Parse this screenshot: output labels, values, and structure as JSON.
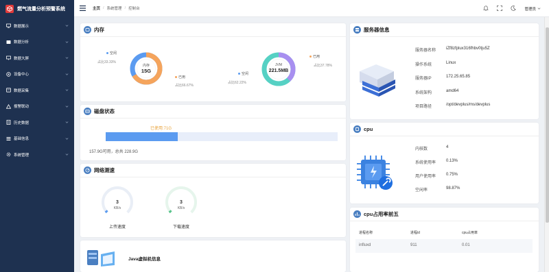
{
  "brand": {
    "title": "燃气流量分析预警系统"
  },
  "sidebar": {
    "items": [
      {
        "label": "数据展示",
        "icon": "monitor-icon"
      },
      {
        "label": "数据分析",
        "icon": "chart-icon"
      },
      {
        "label": "数据大屏",
        "icon": "screen-icon"
      },
      {
        "label": "设备中心",
        "icon": "device-icon"
      },
      {
        "label": "数据采集",
        "icon": "collect-icon"
      },
      {
        "label": "报警联动",
        "icon": "alarm-icon"
      },
      {
        "label": "历史数据",
        "icon": "history-icon"
      },
      {
        "label": "基础信息",
        "icon": "info-icon"
      },
      {
        "label": "系统管理",
        "icon": "gear-icon"
      }
    ]
  },
  "header": {
    "breadcrumb": [
      "主页",
      "系统管理",
      "控制台"
    ],
    "user": "管理员"
  },
  "memory": {
    "title": "内存",
    "ring1": {
      "center_label": "内存",
      "center_value": "15G",
      "free_label": "空闲",
      "free_pct": "占比33.33%",
      "used_label": "已用",
      "used_pct": "占比66.67%",
      "used_fraction": 0.6667
    },
    "ring2": {
      "center_label": "JVM",
      "center_value": "221.5MB",
      "free_label": "空闲",
      "free_pct": "占比62.22%",
      "used_label": "已用",
      "used_pct": "占比37.78%",
      "used_fraction": 0.3778
    }
  },
  "disk": {
    "title": "磁盘状态",
    "used_label": "已使用:71G",
    "used_fraction": 0.31,
    "summary": "157.9G可用，总共 228.9G"
  },
  "network": {
    "title": "网络测速",
    "upload": {
      "value": "3",
      "unit": "KB/s",
      "label": "上传速度"
    },
    "download": {
      "value": "3",
      "unit": "KB/s",
      "label": "下载速度"
    }
  },
  "java": {
    "title": "Java虚拟机信息"
  },
  "server": {
    "title": "服务器信息",
    "rows": [
      {
        "label": "服务器名称",
        "value": "iZf8zfplux316fhbv0tju5Z"
      },
      {
        "label": "操作系统",
        "value": "Linux"
      },
      {
        "label": "服务器IP",
        "value": "172.25.65.85"
      },
      {
        "label": "系统架构",
        "value": "amd64"
      },
      {
        "label": "项目路径",
        "value": "/opt/devplus/ms/devplus"
      }
    ]
  },
  "cpu": {
    "title": "cpu",
    "rows": [
      {
        "label": "内核数",
        "value": "4"
      },
      {
        "label": "系统使用率",
        "value": "0.13%"
      },
      {
        "label": "用户使用率",
        "value": "0.75%"
      },
      {
        "label": "空闲率",
        "value": "98.87%"
      }
    ]
  },
  "cpu_top": {
    "title": "cpu占用率前五",
    "headers": [
      "进程名称",
      "进程id",
      "cpu占用率"
    ],
    "row": [
      "influxd",
      "911",
      "0.01"
    ]
  },
  "colors": {
    "sidebar": "#1e3150",
    "accent": "#4a7fc1",
    "ring_used": "#f5a45c",
    "ring_free": "#5b9bf0",
    "jvm_used": "#a88ff0",
    "jvm_free": "#56d1c4",
    "disk_bar": "#5b9bf0"
  }
}
